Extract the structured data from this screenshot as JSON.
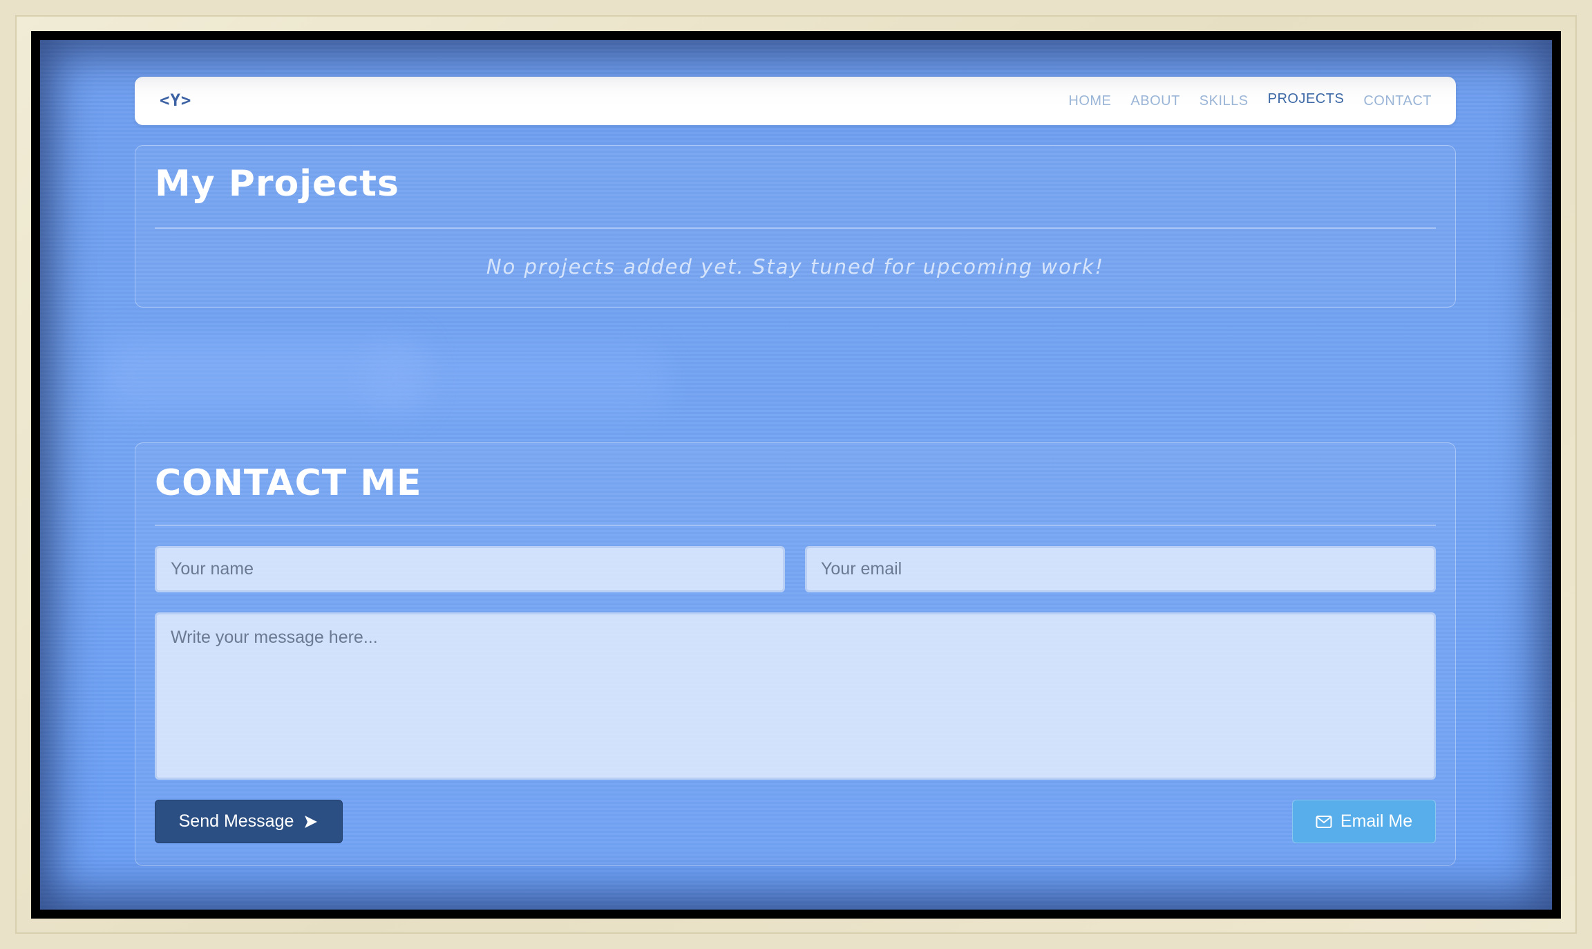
{
  "nav": {
    "logo": "<Y>",
    "links": [
      {
        "label": "HOME",
        "active": false
      },
      {
        "label": "ABOUT",
        "active": false
      },
      {
        "label": "SKILLS",
        "active": false
      },
      {
        "label": "PROJECTS",
        "active": true
      },
      {
        "label": "CONTACT",
        "active": false
      }
    ]
  },
  "projects": {
    "title": "My Projects",
    "empty_message": "No projects added yet. Stay tuned for upcoming work!"
  },
  "contact": {
    "title": "CONTACT ME",
    "name_placeholder": "Your name",
    "email_placeholder": "Your email",
    "message_placeholder": "Write your message here...",
    "send_label": "Send Message",
    "send_icon": "send-arrow-icon",
    "email_label": "Email Me",
    "email_icon": "envelope-icon"
  },
  "colors": {
    "background": "#73a4f3",
    "nav_active": "#3e6aa8",
    "nav_inactive": "#9cb6d8",
    "send_button": "#2c4f83",
    "email_button": "#58aeea"
  }
}
